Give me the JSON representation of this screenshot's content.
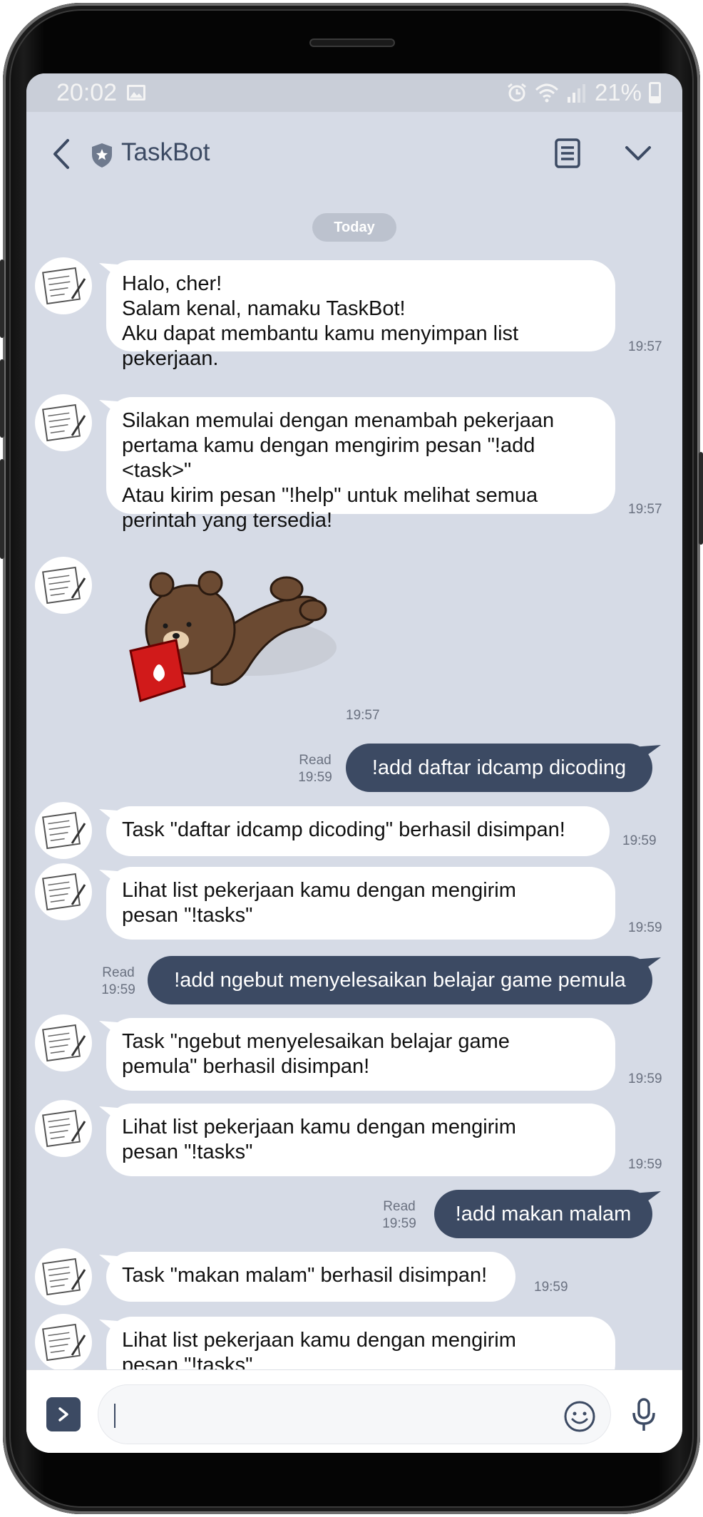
{
  "status_bar": {
    "time": "20:02",
    "battery": "21%",
    "icons": [
      "image-icon",
      "alarm-icon",
      "wifi-icon",
      "signal-icon",
      "battery-icon"
    ]
  },
  "header": {
    "title": "TaskBot",
    "icons": [
      "back-icon",
      "official-shield-icon",
      "notes-icon",
      "chevron-down-icon"
    ]
  },
  "chat": {
    "date_label": "Today",
    "read_label": "Read",
    "messages": [
      {
        "from": "bot",
        "lines": [
          "Halo, cher!",
          "Salam kenal, namaku TaskBot!",
          "Aku dapat membantu kamu menyimpan list",
          "pekerjaan."
        ],
        "time": "19:57"
      },
      {
        "from": "bot",
        "lines": [
          "Silakan memulai dengan menambah pekerjaan",
          "pertama kamu dengan mengirim pesan \"!add",
          "<task>\"",
          "Atau kirim pesan \"!help\" untuk melihat semua",
          "perintah yang tersedia!"
        ],
        "time": "19:57"
      },
      {
        "from": "bot",
        "sticker": "bear-reading-book-sticker",
        "time": "19:57"
      },
      {
        "from": "me",
        "text": "!add daftar idcamp dicoding",
        "time": "19:59",
        "read": true
      },
      {
        "from": "bot",
        "lines": [
          "Task \"daftar idcamp dicoding\" berhasil disimpan!"
        ],
        "time": "19:59"
      },
      {
        "from": "bot",
        "lines": [
          "Lihat list pekerjaan kamu dengan mengirim",
          "pesan \"!tasks\""
        ],
        "time": "19:59"
      },
      {
        "from": "me",
        "text": "!add ngebut menyelesaikan belajar game pemula",
        "time": "19:59",
        "read": true
      },
      {
        "from": "bot",
        "lines": [
          "Task \"ngebut menyelesaikan belajar game",
          "pemula\" berhasil disimpan!"
        ],
        "time": "19:59"
      },
      {
        "from": "bot",
        "lines": [
          "Lihat list pekerjaan kamu dengan mengirim",
          "pesan \"!tasks\""
        ],
        "time": "19:59"
      },
      {
        "from": "me",
        "text": "!add makan malam",
        "time": "19:59",
        "read": true
      },
      {
        "from": "bot",
        "lines": [
          "Task \"makan malam\" berhasil disimpan!"
        ],
        "time": "19:59"
      },
      {
        "from": "bot",
        "lines": [
          "Lihat list pekerjaan kamu dengan mengirim",
          "pesan \"!tasks\""
        ],
        "time": ""
      }
    ]
  },
  "input_bar": {
    "placeholder": "",
    "icons": [
      "expand-icon",
      "emoji-icon",
      "microphone-icon"
    ]
  },
  "colors": {
    "chat_background": "#d6dbe6",
    "outgoing_bubble": "#3c4a63",
    "incoming_bubble": "#ffffff",
    "accent": "#3c4a63"
  }
}
